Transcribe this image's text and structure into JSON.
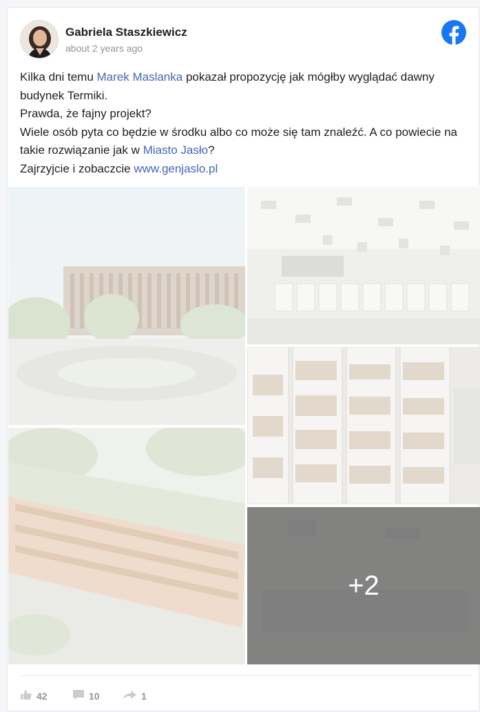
{
  "post": {
    "author": "Gabriela Staszkiewicz",
    "time": "about 2 years ago",
    "text_parts": {
      "p1_a": "Kilka dni temu ",
      "p1_link": "Marek Maslanka",
      "p1_b": " pokazał propozycję jak mógłby wyglądać dawny budynek Termiki.",
      "p2": "Prawda, że fajny projekt?",
      "p3_a": "Wiele osób pyta co będzie w środku albo co może się tam znaleźć. A co powiecie na takie rozwiązanie jak w ",
      "p3_link": "Miasto Jasło",
      "p3_b": "?",
      "p4_a": "Zajrzyjcie i zobaczcie ",
      "p4_link": "www.genjaslo.pl"
    },
    "more_photos": "+2"
  },
  "stats": {
    "likes": "42",
    "comments": "10",
    "shares": "1"
  },
  "icons": {
    "platform": "facebook-icon",
    "like": "thumbs-up-icon",
    "comment": "comment-icon",
    "share": "share-arrow-icon"
  },
  "colors": {
    "link": "#4267b2",
    "facebook": "#1877f2",
    "muted": "#90949c"
  }
}
